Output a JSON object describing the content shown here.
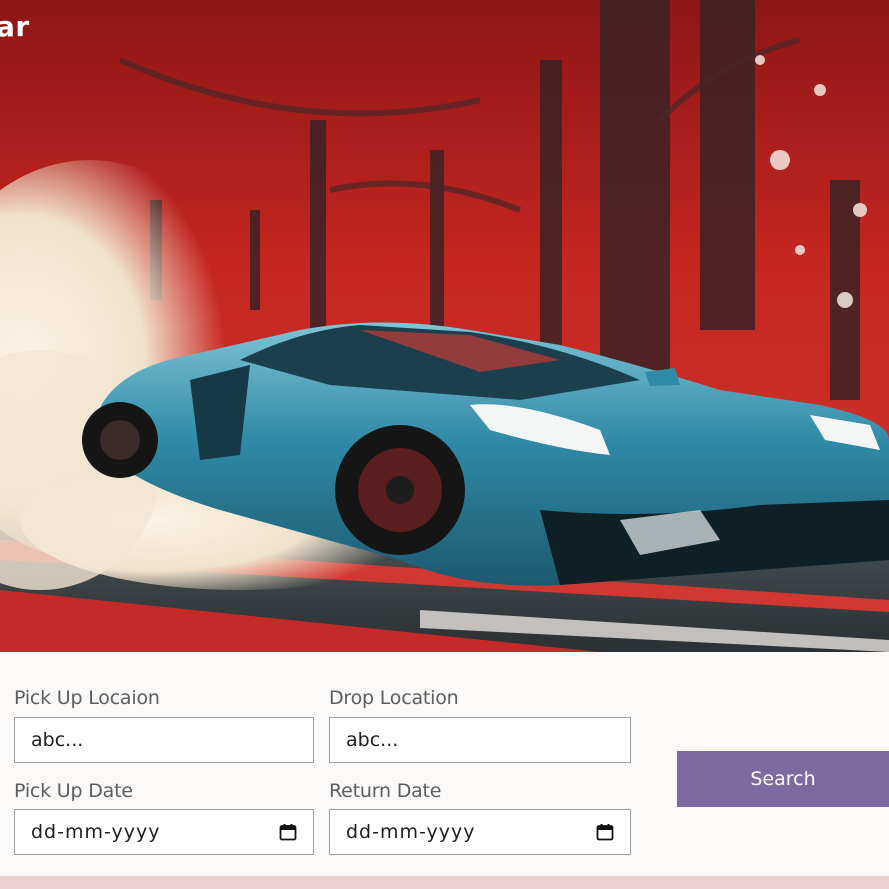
{
  "hero": {
    "title": "ar",
    "image": "sports-car-drifting-in-red-forest"
  },
  "form": {
    "pickup_location": {
      "label": "Pick Up Locaion",
      "value": "abc..."
    },
    "drop_location": {
      "label": "Drop Location",
      "value": "abc..."
    },
    "pickup_date": {
      "label": "Pick Up Date",
      "value": "dd-mm-yyyy",
      "icon": "calendar-icon"
    },
    "return_date": {
      "label": "Return Date",
      "value": "dd-mm-yyyy",
      "icon": "calendar-icon"
    },
    "search_label": "Search"
  },
  "colors": {
    "accent": "#7d6aa1",
    "hero_red": "#c72a24",
    "car_teal": "#2e8aa6",
    "page_bg": "#fcfaf8",
    "bottom_strip": "#ecd1d2"
  }
}
